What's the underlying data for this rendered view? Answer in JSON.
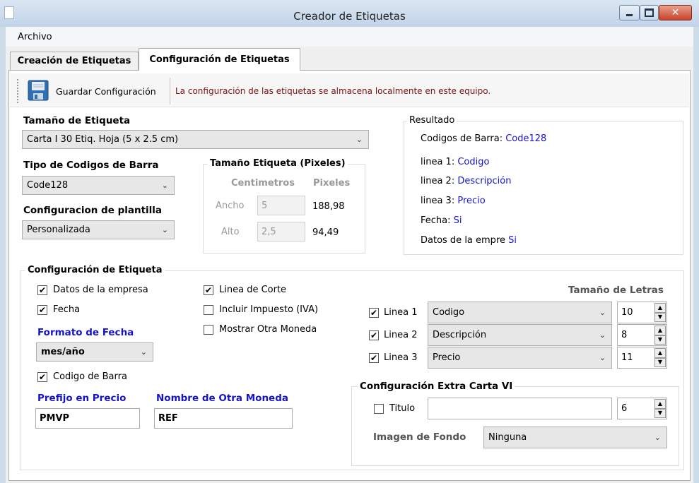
{
  "window": {
    "title": "Creador de Etiquetas",
    "close_glyph": "✕"
  },
  "menu": {
    "archivo": "Archivo"
  },
  "tabs": [
    {
      "label": "Creación de Etiquetas",
      "active": false
    },
    {
      "label": "Configuración de Etiquetas",
      "active": true
    }
  ],
  "toolbar": {
    "save_label": "Guardar Configuración",
    "info_message": "La configuración de las etiquetas se almacena localmente en este equipo.",
    "save_icon": "floppy-disk-icon",
    "info_color": "#7a1010"
  },
  "label_size": {
    "heading": "Tamaño de Etiqueta",
    "selected": "Carta I 30 Etiq. Hoja (5 x 2.5 cm)"
  },
  "barcode_type": {
    "heading": "Tipo de Codigos de Barra",
    "selected": "Code128"
  },
  "template_config": {
    "heading": "Configuracion de plantilla",
    "selected": "Personalizada"
  },
  "pixel_size": {
    "legend": "Tamaño Etiqueta (Pixeles)",
    "col_cm": "Centimetros",
    "col_px": "Pixeles",
    "width_label": "Ancho",
    "width_cm": "5",
    "width_px": "188,98",
    "height_label": "Alto",
    "height_cm": "2,5",
    "height_px": "94,49"
  },
  "result": {
    "legend": "Resultado",
    "barcodes_label": "Codigos de Barra:",
    "barcodes_value": "Code128",
    "line1_label": "linea 1:",
    "line1_value": "Codigo",
    "line2_label": "linea 2:",
    "line2_value": "Descripción",
    "line3_label": "linea 3:",
    "line3_value": "Precio",
    "date_label": "Fecha:",
    "date_value": "Si",
    "company_label": "Datos de la empre",
    "company_value": "Si",
    "value_color": "#1515c8"
  },
  "label_config": {
    "legend": "Configuración de Etiqueta",
    "company_data": {
      "label": "Datos de la empresa",
      "checked": true
    },
    "date": {
      "label": "Fecha",
      "checked": true
    },
    "date_format_heading": "Formato de Fecha",
    "date_format": "mes/año",
    "barcode": {
      "label": "Codigo de Barra",
      "checked": true
    },
    "price_prefix_heading": "Prefijo en Precio",
    "price_prefix": "PMVP",
    "other_currency_heading": "Nombre de Otra Moneda",
    "other_currency": "REF",
    "cut_line": {
      "label": "Linea de Corte",
      "checked": true
    },
    "include_tax": {
      "label": "Incluir Impuesto (IVA)",
      "checked": false
    },
    "show_other_currency": {
      "label": "Mostrar Otra Moneda",
      "checked": false
    },
    "font_size_heading": "Tamaño de Letras",
    "lines": [
      {
        "label": "Linea 1",
        "checked": true,
        "field": "Codigo",
        "size": "10"
      },
      {
        "label": "Linea 2",
        "checked": true,
        "field": "Descripción",
        "size": "8"
      },
      {
        "label": "Linea 3",
        "checked": true,
        "field": "Precio",
        "size": "11"
      }
    ],
    "check_mark": "✔",
    "dropdown_arrow": "⌄",
    "spin_up": "▲",
    "spin_down": "▼"
  },
  "extra_carta": {
    "legend": "Configuración Extra Carta VI",
    "title": {
      "label": "Titulo",
      "checked": false,
      "value": "",
      "size": "6"
    },
    "background_label": "Imagen de Fondo",
    "background_value": "Ninguna"
  }
}
